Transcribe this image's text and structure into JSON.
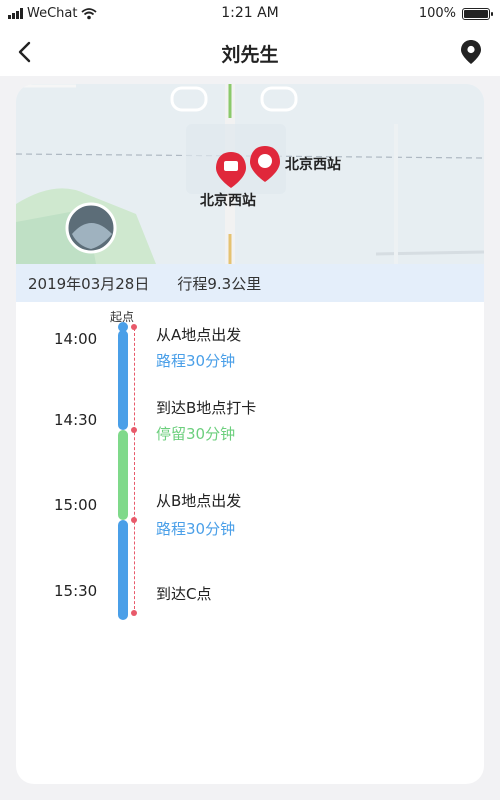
{
  "status_bar": {
    "carrier": "WeChat",
    "time": "1:21 AM",
    "battery_text": "100%",
    "battery_level": 1.0
  },
  "nav": {
    "title": "刘先生",
    "back_icon": "chevron-left-icon",
    "location_icon": "map-pin-icon"
  },
  "map": {
    "station_label_1": "北京西站",
    "station_label_2": "北京西站",
    "date": "2019年03月28日",
    "distance": "行程9.3公里"
  },
  "timeline": {
    "start_label": "起点",
    "events": [
      {
        "time": "14:00",
        "title": "从A地点出发",
        "detail": "路程30分钟",
        "detail_color": "#4a9fe8"
      },
      {
        "time": "14:30",
        "title": "到达B地点打卡",
        "detail": "停留30分钟",
        "detail_color": "#6ccf7d"
      },
      {
        "time": "15:00",
        "title": "从B地点出发",
        "detail": "路程30分钟",
        "detail_color": "#4a9fe8"
      },
      {
        "time": "15:30",
        "title": "到达C点",
        "detail": "",
        "detail_color": "#4a9fe8"
      }
    ],
    "colors": {
      "walk": "#4a9fe8",
      "stay": "#7fd98a",
      "track": "#e85a6a"
    }
  }
}
